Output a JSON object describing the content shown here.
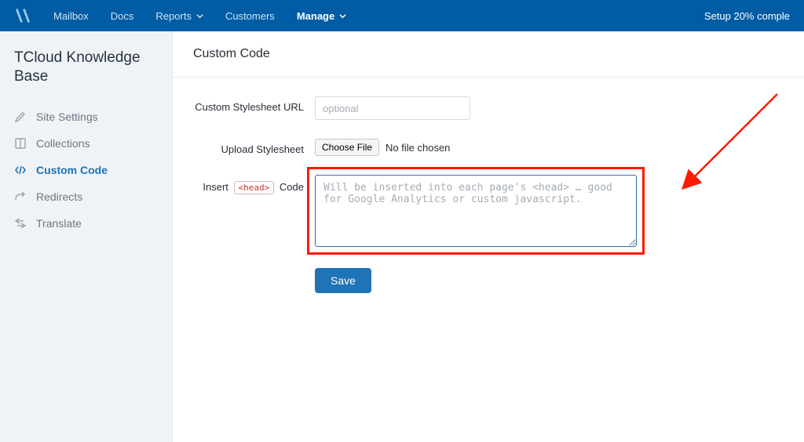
{
  "topbar": {
    "nav": {
      "mailbox": "Mailbox",
      "docs": "Docs",
      "reports": "Reports",
      "customers": "Customers",
      "manage": "Manage"
    },
    "setup_status": "Setup 20% comple"
  },
  "sidebar": {
    "title": "TCloud Knowledge Base",
    "items": [
      {
        "label": "Site Settings"
      },
      {
        "label": "Collections"
      },
      {
        "label": "Custom Code"
      },
      {
        "label": "Redirects"
      },
      {
        "label": "Translate"
      }
    ]
  },
  "main": {
    "heading": "Custom Code",
    "rows": {
      "stylesheet_url": {
        "label": "Custom Stylesheet URL",
        "placeholder": "optional"
      },
      "upload": {
        "label": "Upload Stylesheet",
        "choose_file": "Choose File",
        "no_file": "No file chosen"
      },
      "insert_head": {
        "label_pre": "Insert",
        "tag": "<head>",
        "label_post": "Code",
        "placeholder": "Will be inserted into each page's <head> … good for Google Analytics or custom javascript."
      }
    },
    "save_label": "Save"
  }
}
